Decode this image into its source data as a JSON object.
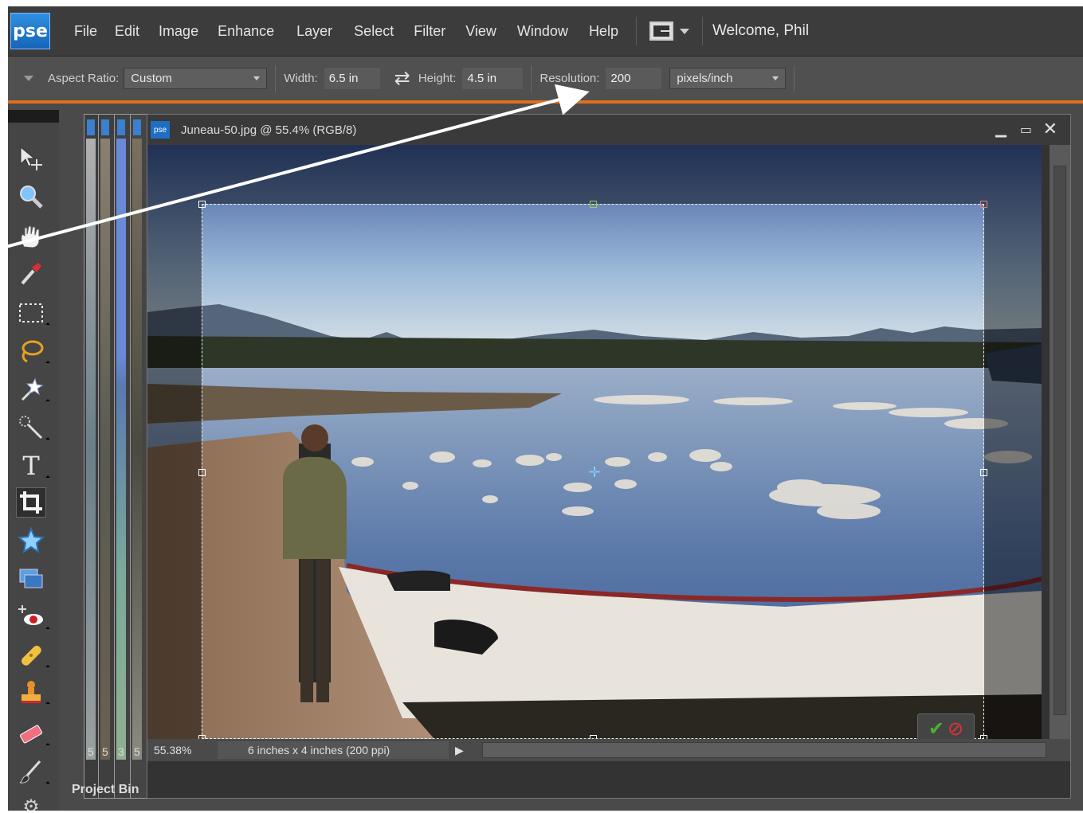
{
  "app": {
    "logo": "pse",
    "welcome": "Welcome, Phil",
    "menu": [
      "File",
      "Edit",
      "Image",
      "Enhance",
      "Layer",
      "Select",
      "Filter",
      "View",
      "Window",
      "Help"
    ]
  },
  "options": {
    "aspect_label": "Aspect Ratio:",
    "aspect_value": "Custom",
    "width_label": "Width:",
    "width_value": "6.5 in",
    "height_label": "Height:",
    "height_value": "4.5 in",
    "resolution_label": "Resolution:",
    "resolution_value": "200",
    "resolution_unit": "pixels/inch"
  },
  "stack_numbers": [
    "5",
    "5",
    "3",
    "5"
  ],
  "document": {
    "badge": "pse",
    "title": "Juneau-50.jpg @ 55.4% (RGB/8)",
    "zoom": "55.38%",
    "info": "6 inches x 4 inches (200 ppi)"
  },
  "project_bin": "Project Bin",
  "colors": {
    "accent_orange": "#e0701e",
    "brand_blue": "#1e6fc4",
    "commit_green": "#4caf32",
    "cancel_red": "#e0303a"
  },
  "icons": {
    "tools": [
      "move-tool-icon",
      "zoom-tool-icon",
      "hand-tool-icon",
      "eyedropper-tool-icon",
      "marquee-tool-icon",
      "lasso-tool-icon",
      "magic-wand-tool-icon",
      "quick-selection-tool-icon",
      "type-tool-icon",
      "crop-tool-icon",
      "cookie-cutter-tool-icon",
      "straighten-tool-icon",
      "red-eye-tool-icon",
      "healing-brush-tool-icon",
      "clone-stamp-tool-icon",
      "eraser-tool-icon",
      "brush-tool-icon",
      "settings-icon"
    ]
  }
}
